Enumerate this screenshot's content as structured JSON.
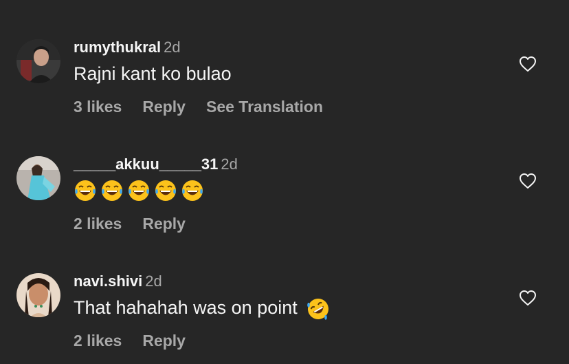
{
  "comments": [
    {
      "username": "rumythukral",
      "time": "2d",
      "text": "Rajni kant ko bulao",
      "likes": "3 likes",
      "reply": "Reply",
      "translation": "See Translation",
      "avatar_icon": "user-avatar-icon"
    },
    {
      "username": "_____akkuu_____31",
      "time": "2d",
      "emoji": "face-with-tears-of-joy",
      "emoji_count": 5,
      "likes": "2 likes",
      "reply": "Reply",
      "avatar_icon": "user-avatar-icon"
    },
    {
      "username": "navi.shivi",
      "time": "2d",
      "text": "That hahahah was on point",
      "emoji": "rolling-on-the-floor-laughing",
      "likes": "2 likes",
      "reply": "Reply",
      "avatar_icon": "user-avatar-icon"
    }
  ],
  "colors": {
    "background": "#262626",
    "primary_text": "#f5f5f5",
    "secondary_text": "#a8a8a8",
    "emoji_yellow": "#fcc21b",
    "tear_blue": "#3ba7f4"
  },
  "like_icon": "heart-outline-icon"
}
